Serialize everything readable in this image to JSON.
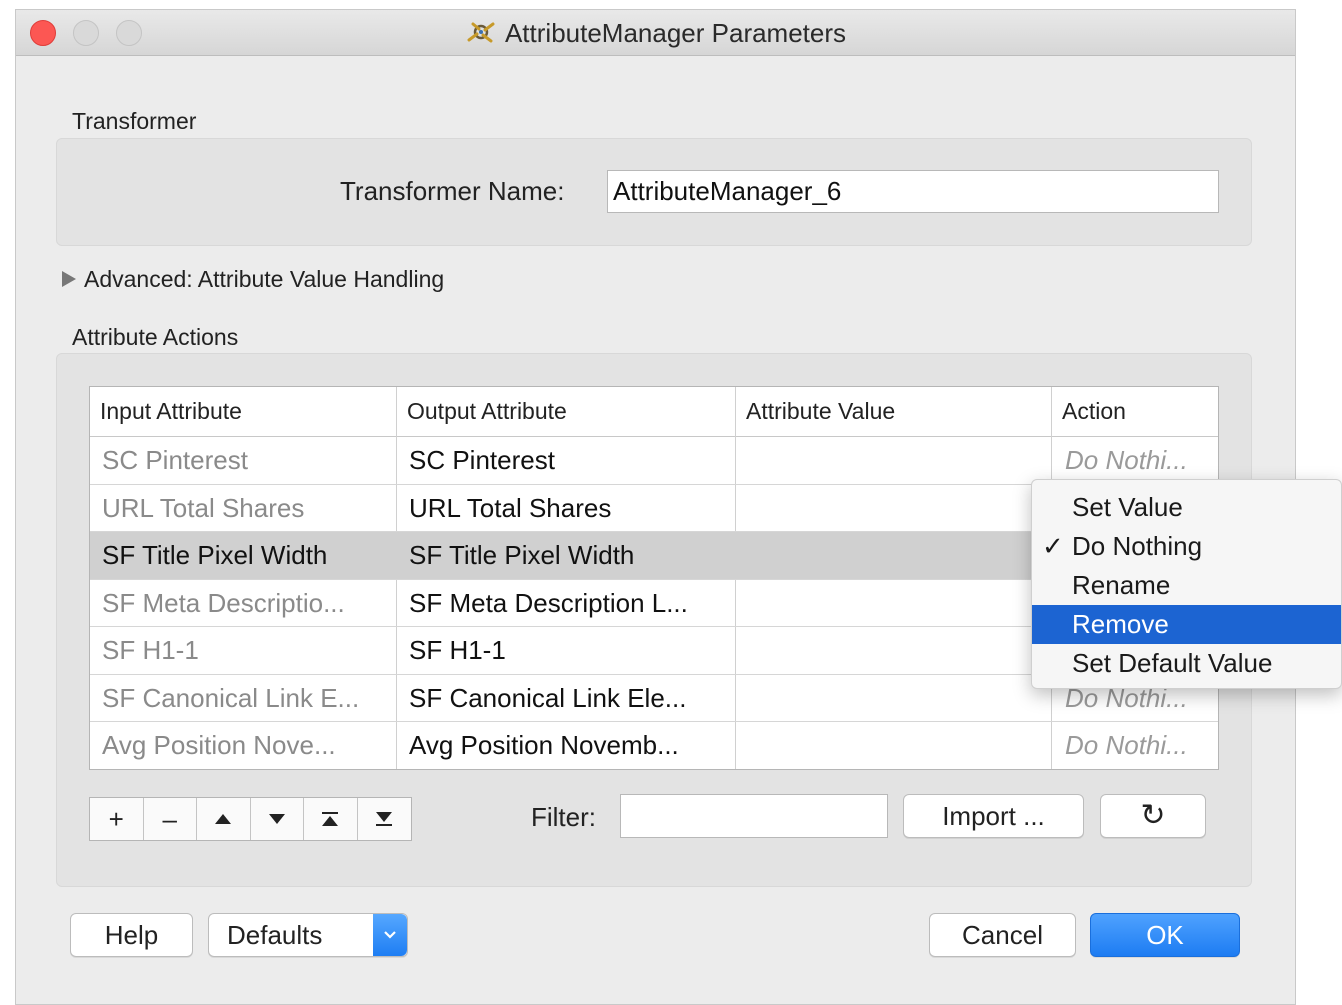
{
  "window": {
    "title": "AttributeManager Parameters"
  },
  "transformer": {
    "section_label": "Transformer",
    "name_label": "Transformer Name:",
    "name_value": "AttributeManager_6"
  },
  "advanced": {
    "label": "Advanced: Attribute Value Handling"
  },
  "attribute_actions": {
    "section_label": "Attribute Actions",
    "headers": [
      "Input Attribute",
      "Output Attribute",
      "Attribute Value",
      "Action"
    ],
    "rows": [
      {
        "input": "SC Pinterest",
        "output": "SC Pinterest",
        "value": "",
        "action": "Do Nothi..."
      },
      {
        "input": "URL Total Shares",
        "output": "URL Total Shares",
        "value": "",
        "action": ""
      },
      {
        "input": "SF Title Pixel Width",
        "output": "SF Title Pixel Width",
        "value": "",
        "action": ""
      },
      {
        "input": "SF Meta Descriptio...",
        "output": "SF Meta Description L...",
        "value": "",
        "action": ""
      },
      {
        "input": "SF H1-1",
        "output": "SF H1-1",
        "value": "",
        "action": ""
      },
      {
        "input": "SF Canonical Link E...",
        "output": "SF Canonical Link Ele...",
        "value": "",
        "action": "Do Nothi..."
      },
      {
        "input": "Avg Position Nove...",
        "output": "Avg Position Novemb...",
        "value": "",
        "action": "Do Nothi..."
      }
    ],
    "selected_row": 2
  },
  "toolbar": {
    "add": "+",
    "remove": "–",
    "filter_label": "Filter:",
    "filter_value": "",
    "import_label": "Import ...",
    "refresh_icon": "↻"
  },
  "action_menu": {
    "items": [
      "Set Value",
      "Do Nothing",
      "Rename",
      "Remove",
      "Set Default Value"
    ],
    "checked": "Do Nothing",
    "highlighted": "Remove",
    "check_glyph": "✓"
  },
  "footer": {
    "help": "Help",
    "defaults": "Defaults",
    "cancel": "Cancel",
    "ok": "OK"
  },
  "colors": {
    "accent": "#1d7cf2",
    "menu_highlight": "#1c64d2",
    "close_button": "#fc5753"
  }
}
